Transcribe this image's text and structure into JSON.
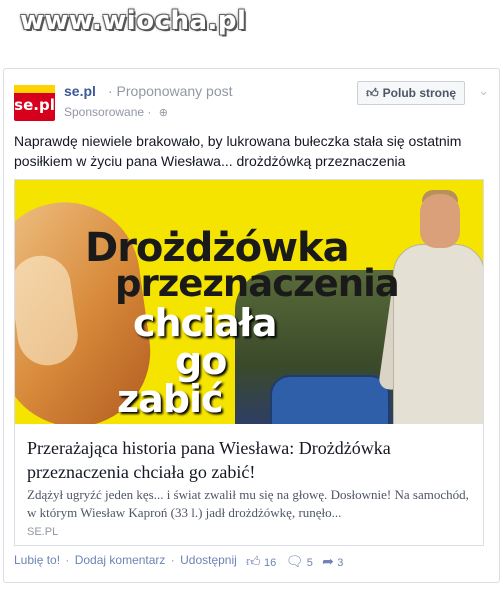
{
  "watermark": "www.wiocha.pl",
  "post": {
    "page_name": "se.pl",
    "suggested_label": "· Proponowany post",
    "sponsored_label": "Sponsorowane ·",
    "like_page_button": "Polub stronę",
    "logo_text": "se.pl",
    "text": "Naprawdę niewiele brakowało, by lukrowana bułeczka stała się ostatnim posiłkiem w życiu pana Wiesława... drożdżówką przeznaczenia"
  },
  "hero": {
    "line1": "Drożdżówka",
    "line2": "przeznaczenia",
    "line3": "chciała",
    "line4": "go",
    "line5": "zabić"
  },
  "link": {
    "title": "Przerażająca historia pana Wiesława: Drożdżówka przeznaczenia chciała go zabić!",
    "description": "Zdążył ugryźć jeden kęs... i świat zwalił mu się na głowę. Dosłownie! Na samochód, w którym Wiesław Kaproń (33 l.) jadł drożdżówkę, runęło...",
    "domain": "SE.PL"
  },
  "footer": {
    "like": "Lubię to!",
    "comment": "Dodaj komentarz",
    "share": "Udostępnij",
    "likes_count": "16",
    "comments_count": "5",
    "shares_count": "3"
  },
  "colors": {
    "link_blue": "#3b5998",
    "hero_yellow": "#f5e400",
    "logo_red": "#d6001c"
  },
  "icons": [
    "thumbs-up-icon",
    "globe-icon",
    "chevron-down-icon",
    "comment-icon",
    "share-icon"
  ]
}
